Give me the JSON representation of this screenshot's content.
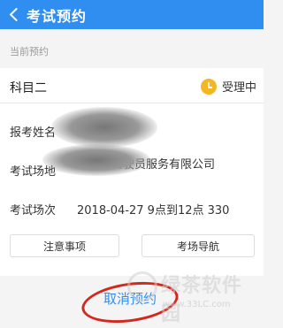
{
  "header": {
    "title": "考试预约"
  },
  "section": {
    "current_label": "当前预约"
  },
  "appointment": {
    "subject": "科目二",
    "status": "受理中",
    "name_label": "报考姓名",
    "venue_label": "考试场地",
    "venue_value": "驾动车驾驶员服务有限公司",
    "time_label": "考试场次",
    "time_value": "2018-04-27 9点到12点 330"
  },
  "buttons": {
    "notice": "注意事项",
    "navigation": "考场导航",
    "cancel": "取消预约"
  },
  "watermark": {
    "main": "绿茶软件园",
    "sub": "www.33LC.com"
  },
  "colors": {
    "primary": "#2f8ef0",
    "status": "#f5b623",
    "annotation": "#d4281c"
  }
}
